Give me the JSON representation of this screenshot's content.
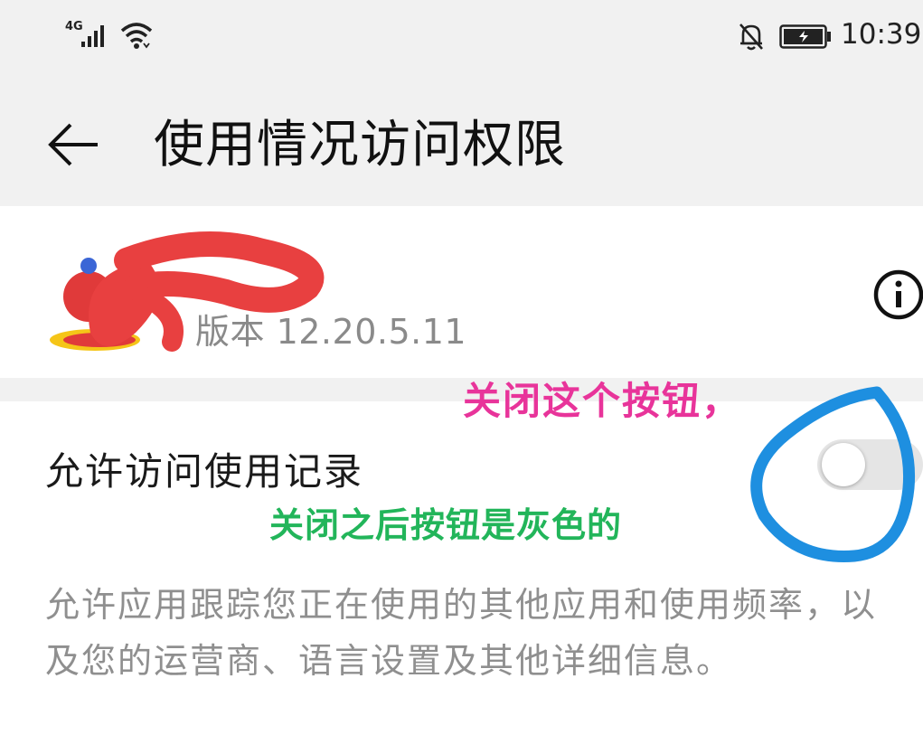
{
  "status_bar": {
    "network": "4G",
    "time": "10:39",
    "icons": [
      "signal-icon",
      "wifi-icon",
      "bell-muted-icon",
      "battery-charging-icon"
    ]
  },
  "header": {
    "title": "使用情况访问权限",
    "back_icon": "back-arrow-icon"
  },
  "app": {
    "name": "",
    "version": "版本 12.20.5.11",
    "info_icon": "info-icon"
  },
  "setting": {
    "label": "允许访问使用记录",
    "toggle_on": false,
    "description": "允许应用跟踪您正在使用的其他应用和使用频率，以及您的运营商、语言设置及其他详细信息。"
  },
  "annotations": {
    "pink_note": "关闭这个按钮，",
    "green_note": "关闭之后按钮是灰色的"
  },
  "colors": {
    "pink_annotation": "#e8349a",
    "green_annotation": "#22b55a",
    "blue_circle": "#1e8fe0",
    "red_scribble": "#e84040"
  }
}
